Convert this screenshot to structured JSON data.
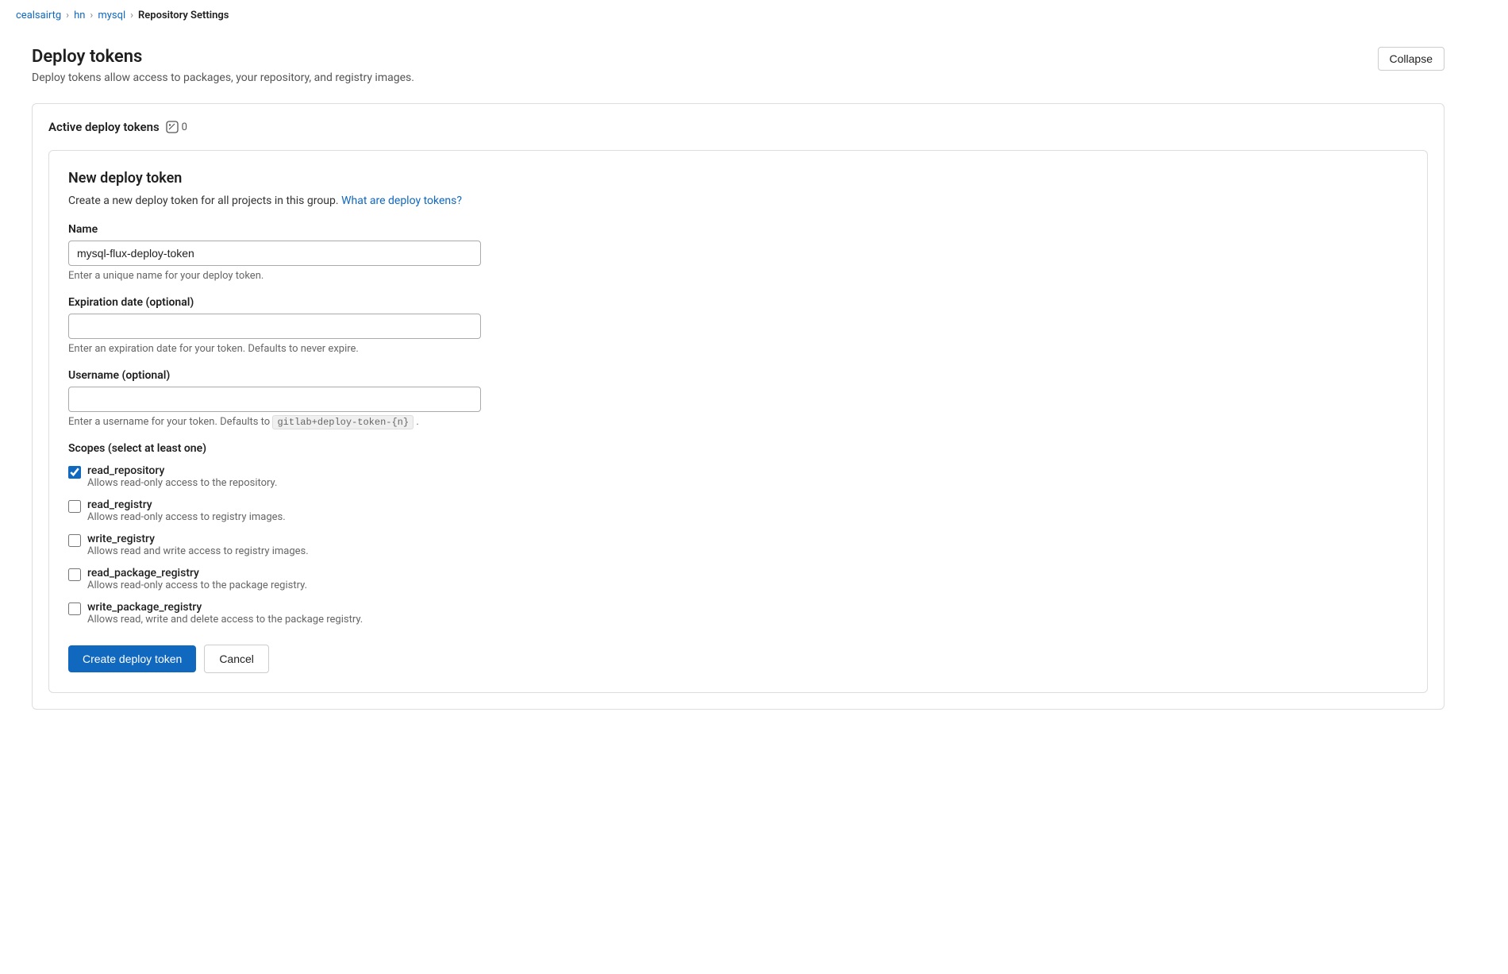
{
  "breadcrumb": {
    "items": [
      {
        "label": "cealsairtg",
        "href": "#"
      },
      {
        "label": "hn",
        "href": "#"
      },
      {
        "label": "mysql",
        "href": "#"
      },
      {
        "label": "Repository Settings",
        "current": true
      }
    ]
  },
  "page": {
    "title": "Deploy tokens",
    "subtitle": "Deploy tokens allow access to packages, your repository, and registry images.",
    "collapse_button": "Collapse"
  },
  "active_tokens": {
    "label": "Active deploy tokens",
    "count": "0"
  },
  "form": {
    "title": "New deploy token",
    "description_text": "Create a new deploy token for all projects in this group.",
    "description_link": "What are deploy tokens?",
    "name_label": "Name",
    "name_value": "mysql-flux-deploy-token",
    "name_hint": "Enter a unique name for your deploy token.",
    "expiration_label": "Expiration date (optional)",
    "expiration_value": "",
    "expiration_placeholder": "",
    "expiration_hint": "Enter an expiration date for your token. Defaults to never expire.",
    "username_label": "Username (optional)",
    "username_value": "",
    "username_placeholder": "",
    "username_hint_prefix": "Enter a username for your token. Defaults to",
    "username_hint_code": "gitlab+deploy-token-{n}",
    "username_hint_suffix": ".",
    "scopes_label": "Scopes (select at least one)",
    "scopes": [
      {
        "id": "read_repository",
        "name": "read_repository",
        "description": "Allows read-only access to the repository.",
        "checked": true
      },
      {
        "id": "read_registry",
        "name": "read_registry",
        "description": "Allows read-only access to registry images.",
        "checked": false
      },
      {
        "id": "write_registry",
        "name": "write_registry",
        "description": "Allows read and write access to registry images.",
        "checked": false
      },
      {
        "id": "read_package_registry",
        "name": "read_package_registry",
        "description": "Allows read-only access to the package registry.",
        "checked": false
      },
      {
        "id": "write_package_registry",
        "name": "write_package_registry",
        "description": "Allows read, write and delete access to the package registry.",
        "checked": false
      }
    ],
    "submit_label": "Create deploy token",
    "cancel_label": "Cancel"
  }
}
